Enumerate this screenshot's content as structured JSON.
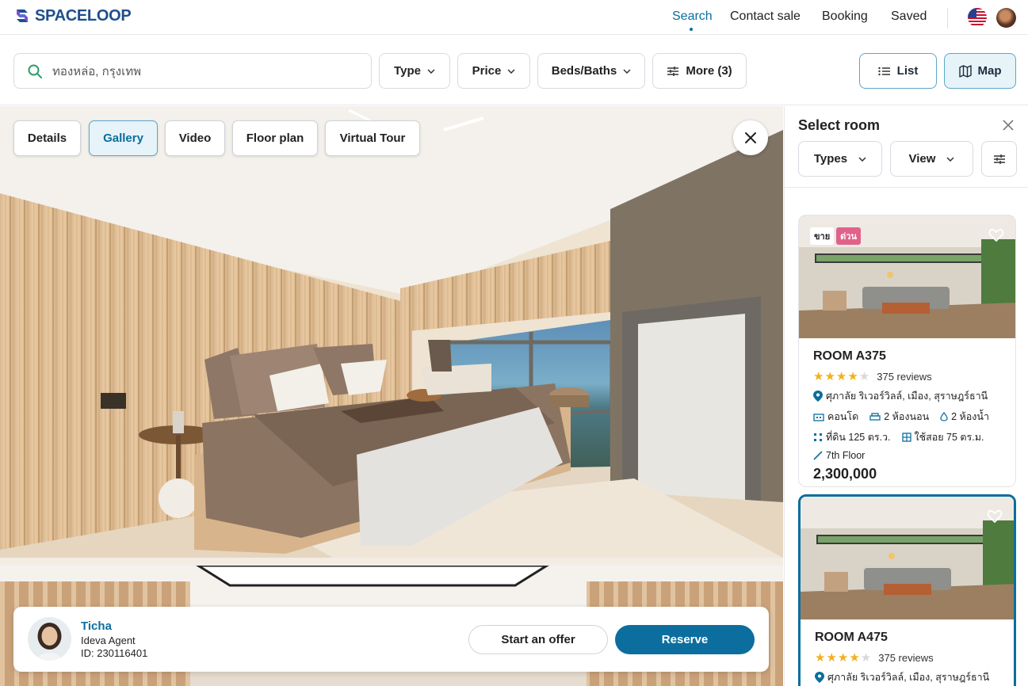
{
  "app": {
    "brand": "SPACELOOP"
  },
  "nav": {
    "items": [
      {
        "label": "Search",
        "active": true
      },
      {
        "label": "Contact sale"
      },
      {
        "label": "Booking"
      },
      {
        "label": "Saved"
      }
    ],
    "flag_icon": "us-flag-icon"
  },
  "filters": {
    "search_value": "ทองหล่อ, กรุงเทพ",
    "type_label": "Type",
    "price_label": "Price",
    "beds_label": "Beds/Baths",
    "more_label": "More (3)",
    "list_label": "List",
    "map_label": "Map",
    "active_view": "Map"
  },
  "gallery": {
    "tabs": [
      "Details",
      "Gallery",
      "Video",
      "Floor plan",
      "Virtual Tour"
    ],
    "active_tab": "Gallery"
  },
  "agent": {
    "name": "Ticha",
    "role": "Ideva Agent",
    "id_text": "ID: 230116401",
    "offer_label": "Start an offer",
    "reserve_label": "Reserve"
  },
  "panel": {
    "title": "Select room",
    "types_label": "Types",
    "view_label": "View"
  },
  "rooms": [
    {
      "badge_sell": "ขาย",
      "badge_urgent": "ด่วน",
      "name": "ROOM A375",
      "rating": 4,
      "reviews": "375 reviews",
      "location": "ศุภาลัย ริเวอร์วิลล์, เมือง, สุราษฎร์ธานี",
      "property_type": "คอนโด",
      "bedrooms": "2 ห้องนอน",
      "bathrooms": "2 ห้องน้ำ",
      "land": "ที่ดิน 125 ตร.ว.",
      "usable": "ใช้สอย 75 ตร.ม.",
      "floor": "7th Floor",
      "price": "2,300,000",
      "selected": false
    },
    {
      "name": "ROOM A475",
      "rating": 4,
      "reviews": "375 reviews",
      "location": "ศุภาลัย ริเวอร์วิลล์, เมือง, สุราษฎร์ธานี",
      "selected": true
    }
  ],
  "colors": {
    "accent": "#0b6e9e",
    "brand": "#1f4e8c",
    "star": "#f2b01e",
    "urgent_badge": "#e0628a"
  }
}
